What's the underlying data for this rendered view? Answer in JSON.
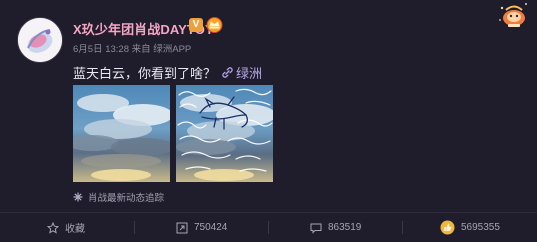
{
  "post": {
    "author": "X玖少年团肖战DAYTOY",
    "verified_mark": "V",
    "meta": "6月5日 13:28 来自 绿洲APP",
    "text": "蓝天白云，你看到了啥？",
    "link_label": "绿洲",
    "footer_tag": "肖战最新动态追踪"
  },
  "actions": {
    "favorite_label": "收藏",
    "repost_count": "750424",
    "comment_count": "863519",
    "like_count": "5695355"
  },
  "colors": {
    "background": "#1f1d2b",
    "author_name": "#f7a5c3",
    "link": "#b6a6ea",
    "verified_badge": "#f0a03a",
    "like_icon": "#f4b53f"
  },
  "icons": [
    "avatar",
    "verified-icon",
    "crown-badge-icon",
    "decoration-sticker-icon",
    "link-icon",
    "sparkle-icon",
    "favorite-icon",
    "repost-icon",
    "comment-icon",
    "like-icon"
  ]
}
